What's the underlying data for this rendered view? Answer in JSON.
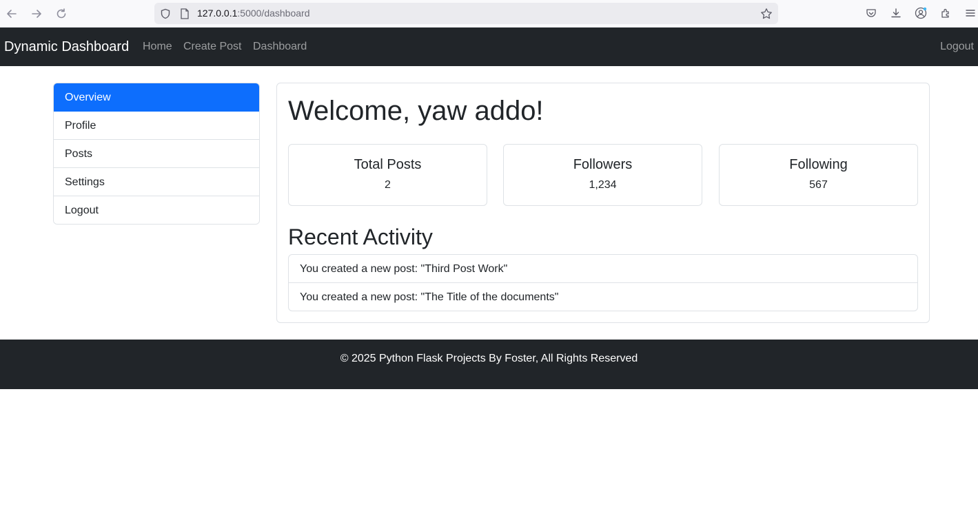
{
  "browser": {
    "url_host": "127.0.0.1",
    "url_path": ":5000/dashboard"
  },
  "navbar": {
    "brand": "Dynamic Dashboard",
    "links": [
      "Home",
      "Create Post",
      "Dashboard"
    ],
    "logout": "Logout"
  },
  "sidebar": {
    "items": [
      {
        "label": "Overview",
        "active": true
      },
      {
        "label": "Profile",
        "active": false
      },
      {
        "label": "Posts",
        "active": false
      },
      {
        "label": "Settings",
        "active": false
      },
      {
        "label": "Logout",
        "active": false
      }
    ]
  },
  "main": {
    "welcome": "Welcome, yaw addo!",
    "stats": [
      {
        "title": "Total Posts",
        "value": "2"
      },
      {
        "title": "Followers",
        "value": "1,234"
      },
      {
        "title": "Following",
        "value": "567"
      }
    ],
    "recent_title": "Recent Activity",
    "activities": [
      "You created a new post: \"Third Post Work\"",
      "You created a new post: \"The Title of the documents\""
    ]
  },
  "footer": {
    "text": "© 2025 Python Flask Projects By Foster, All Rights Reserved"
  },
  "colors": {
    "primary": "#0d6efd",
    "dark": "#212529"
  }
}
